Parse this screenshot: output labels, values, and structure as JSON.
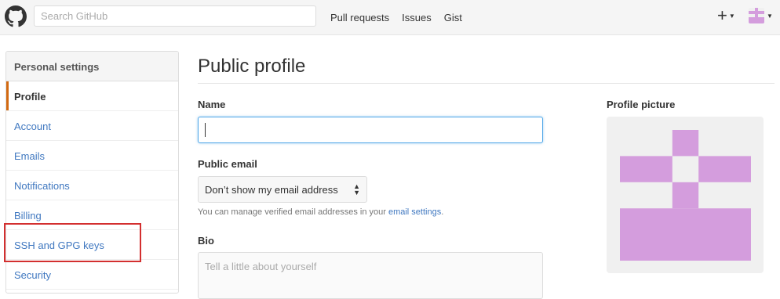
{
  "header": {
    "search_placeholder": "Search GitHub",
    "nav": [
      "Pull requests",
      "Issues",
      "Gist"
    ],
    "plus_icon": "plus-icon",
    "caret_icon": "caret-down-icon"
  },
  "sidebar": {
    "title": "Personal settings",
    "items": [
      {
        "label": "Profile",
        "active": true
      },
      {
        "label": "Account",
        "active": false
      },
      {
        "label": "Emails",
        "active": false
      },
      {
        "label": "Notifications",
        "active": false
      },
      {
        "label": "Billing",
        "active": false
      },
      {
        "label": "SSH and GPG keys",
        "active": false
      },
      {
        "label": "Security",
        "active": false
      }
    ],
    "highlighted_item": "SSH and GPG keys",
    "active_accent": "#d26911",
    "highlight_color": "#d32f2f"
  },
  "main": {
    "title": "Public profile",
    "name_label": "Name",
    "name_value": "",
    "email_label": "Public email",
    "email_selected": "Don’t show my email address",
    "email_note": "You can manage verified email addresses in your ",
    "email_note_link": "email settings",
    "email_note_end": ".",
    "bio_label": "Bio",
    "bio_placeholder": "Tell a little about yourself"
  },
  "profile_picture": {
    "label": "Profile picture",
    "identicon_color": "#d49ddd"
  },
  "colors": {
    "link": "#4078c0",
    "focus_border": "#51a7e8"
  }
}
